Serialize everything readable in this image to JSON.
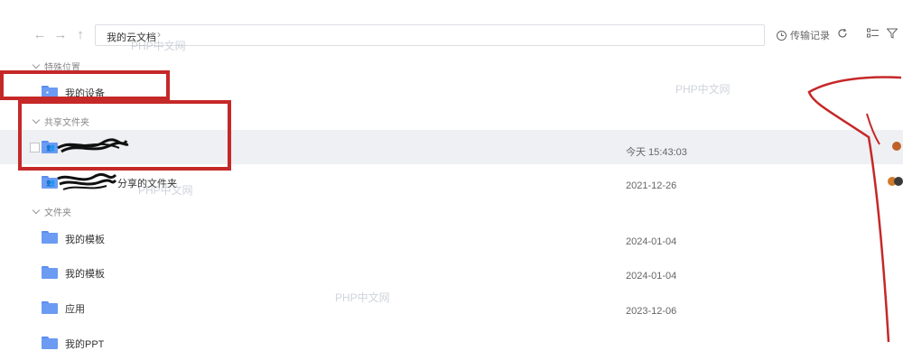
{
  "toolbar": {
    "breadcrumb": "我的云文档",
    "transfer_label": "传输记录"
  },
  "sections": {
    "special": "特殊位置",
    "shared": "共享文件夹",
    "folders": "文件夹"
  },
  "special_items": [
    {
      "name": "我的设备",
      "icon": "device-folder-icon"
    }
  ],
  "shared_items": [
    {
      "name": "",
      "date": "今天 15:43:03",
      "selected": true
    },
    {
      "name": "分享的文件夹",
      "date": "2021-12-26",
      "selected": false
    }
  ],
  "folder_items": [
    {
      "name": "我的模板",
      "date": "2024-01-04"
    },
    {
      "name": "我的模板",
      "date": "2024-01-04"
    },
    {
      "name": "应用",
      "date": "2023-12-06"
    },
    {
      "name": "我的PPT",
      "date": ""
    }
  ],
  "watermark": "PHP中文网",
  "colors": {
    "annotation_red": "#c62828",
    "folder_blue": "#6b9bf2",
    "selected_row": "#eef0f3"
  }
}
